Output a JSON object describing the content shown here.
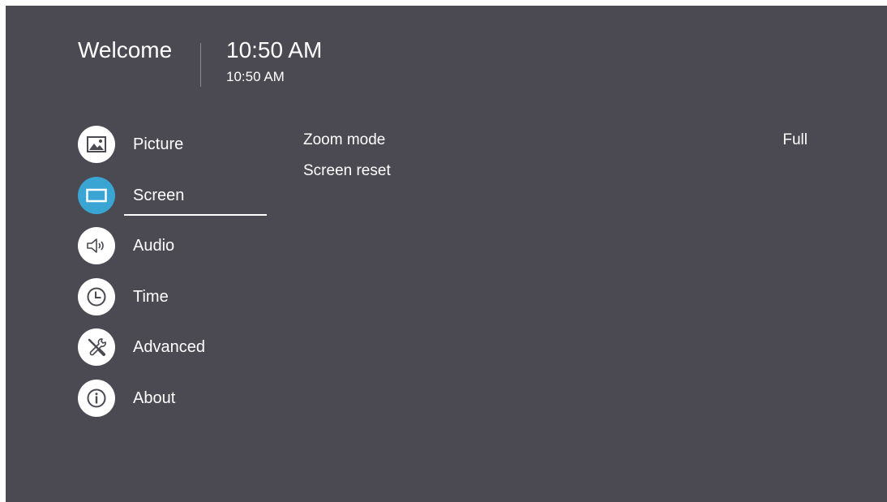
{
  "header": {
    "welcome": "Welcome",
    "clock_large": "10:50 AM",
    "clock_small": "10:50 AM"
  },
  "menu": {
    "active": "Screen",
    "items": [
      {
        "label": "Picture",
        "icon": "picture-icon"
      },
      {
        "label": "Screen",
        "icon": "screen-icon"
      },
      {
        "label": "Audio",
        "icon": "audio-icon"
      },
      {
        "label": "Time",
        "icon": "clock-icon"
      },
      {
        "label": "Advanced",
        "icon": "tools-icon"
      },
      {
        "label": "About",
        "icon": "info-icon"
      }
    ]
  },
  "content": {
    "options": [
      {
        "label": "Zoom mode",
        "value": "Full"
      },
      {
        "label": "Screen reset",
        "value": ""
      }
    ]
  },
  "colors": {
    "background": "#4b4a52",
    "accent": "#3aa5d3",
    "text": "#ffffff"
  }
}
